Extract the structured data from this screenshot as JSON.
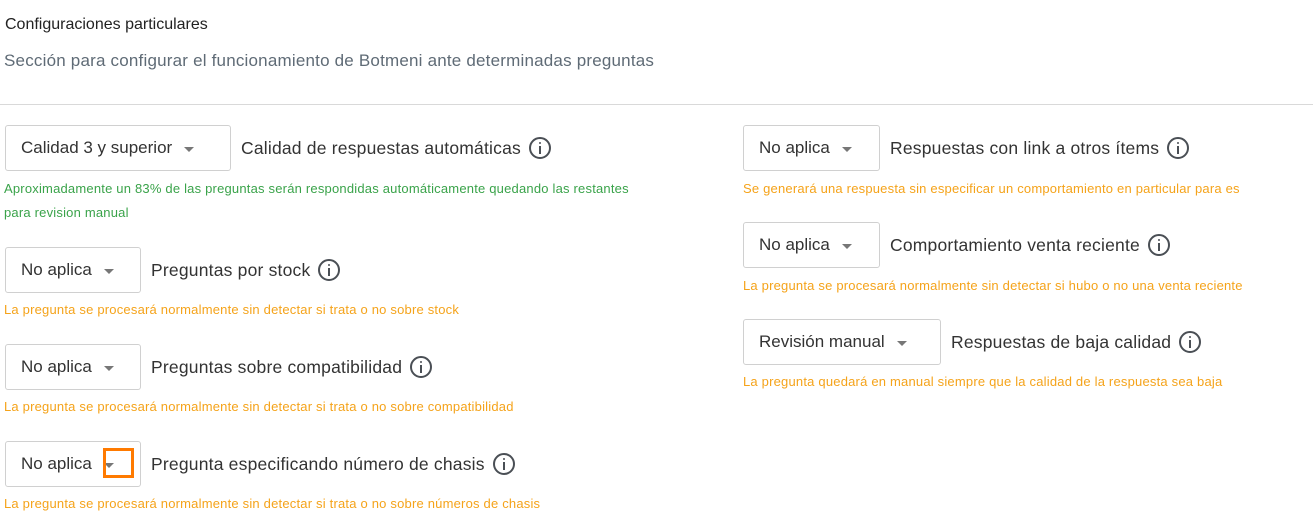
{
  "header": {
    "title": "Configuraciones particulares",
    "subtitle": "Sección para configurar el funcionamiento de Botmeni ante determinadas preguntas"
  },
  "left": [
    {
      "select": "Calidad 3 y superior",
      "label": "Calidad de respuestas automáticas",
      "hint_line1": "Aproximadamente un 83% de las preguntas serán respondidas automáticamente quedando las restantes",
      "hint_line2": "para revision manual",
      "hint_color": "#3aa34a"
    },
    {
      "select": "No aplica",
      "label": "Preguntas por stock",
      "hint_line1": "La pregunta se procesará normalmente sin detectar si trata o no sobre stock",
      "hint_color": "#f5a31a"
    },
    {
      "select": "No aplica",
      "label": "Preguntas sobre compatibilidad",
      "hint_line1": "La pregunta se procesará normalmente sin detectar si trata o no sobre compatibilidad",
      "hint_color": "#f5a31a"
    },
    {
      "select": "No aplica",
      "label": "Pregunta especificando número de chasis",
      "hint_line1": "La pregunta se procesará normalmente sin detectar si trata o no sobre números de chasis",
      "hint_color": "#f5a31a"
    }
  ],
  "right": [
    {
      "select": "No aplica",
      "label": "Respuestas con link a otros ítems",
      "hint_line1": "Se generará una respuesta sin especificar un comportamiento en particular para es",
      "hint_color": "#f5a31a"
    },
    {
      "select": "No aplica",
      "label": "Comportamiento venta reciente",
      "hint_line1": "La pregunta se procesará normalmente sin detectar si hubo o no una venta reciente",
      "hint_color": "#f5a31a"
    },
    {
      "select": "Revisión manual",
      "label": "Respuestas de baja calidad",
      "hint_line1": "La pregunta quedará en manual siempre que la calidad de la respuesta sea baja",
      "hint_color": "#f5a31a"
    }
  ],
  "icons": {
    "info": "info-circle-icon",
    "dropdown": "caret-down-icon"
  },
  "highlight_color": "#ff7a00"
}
